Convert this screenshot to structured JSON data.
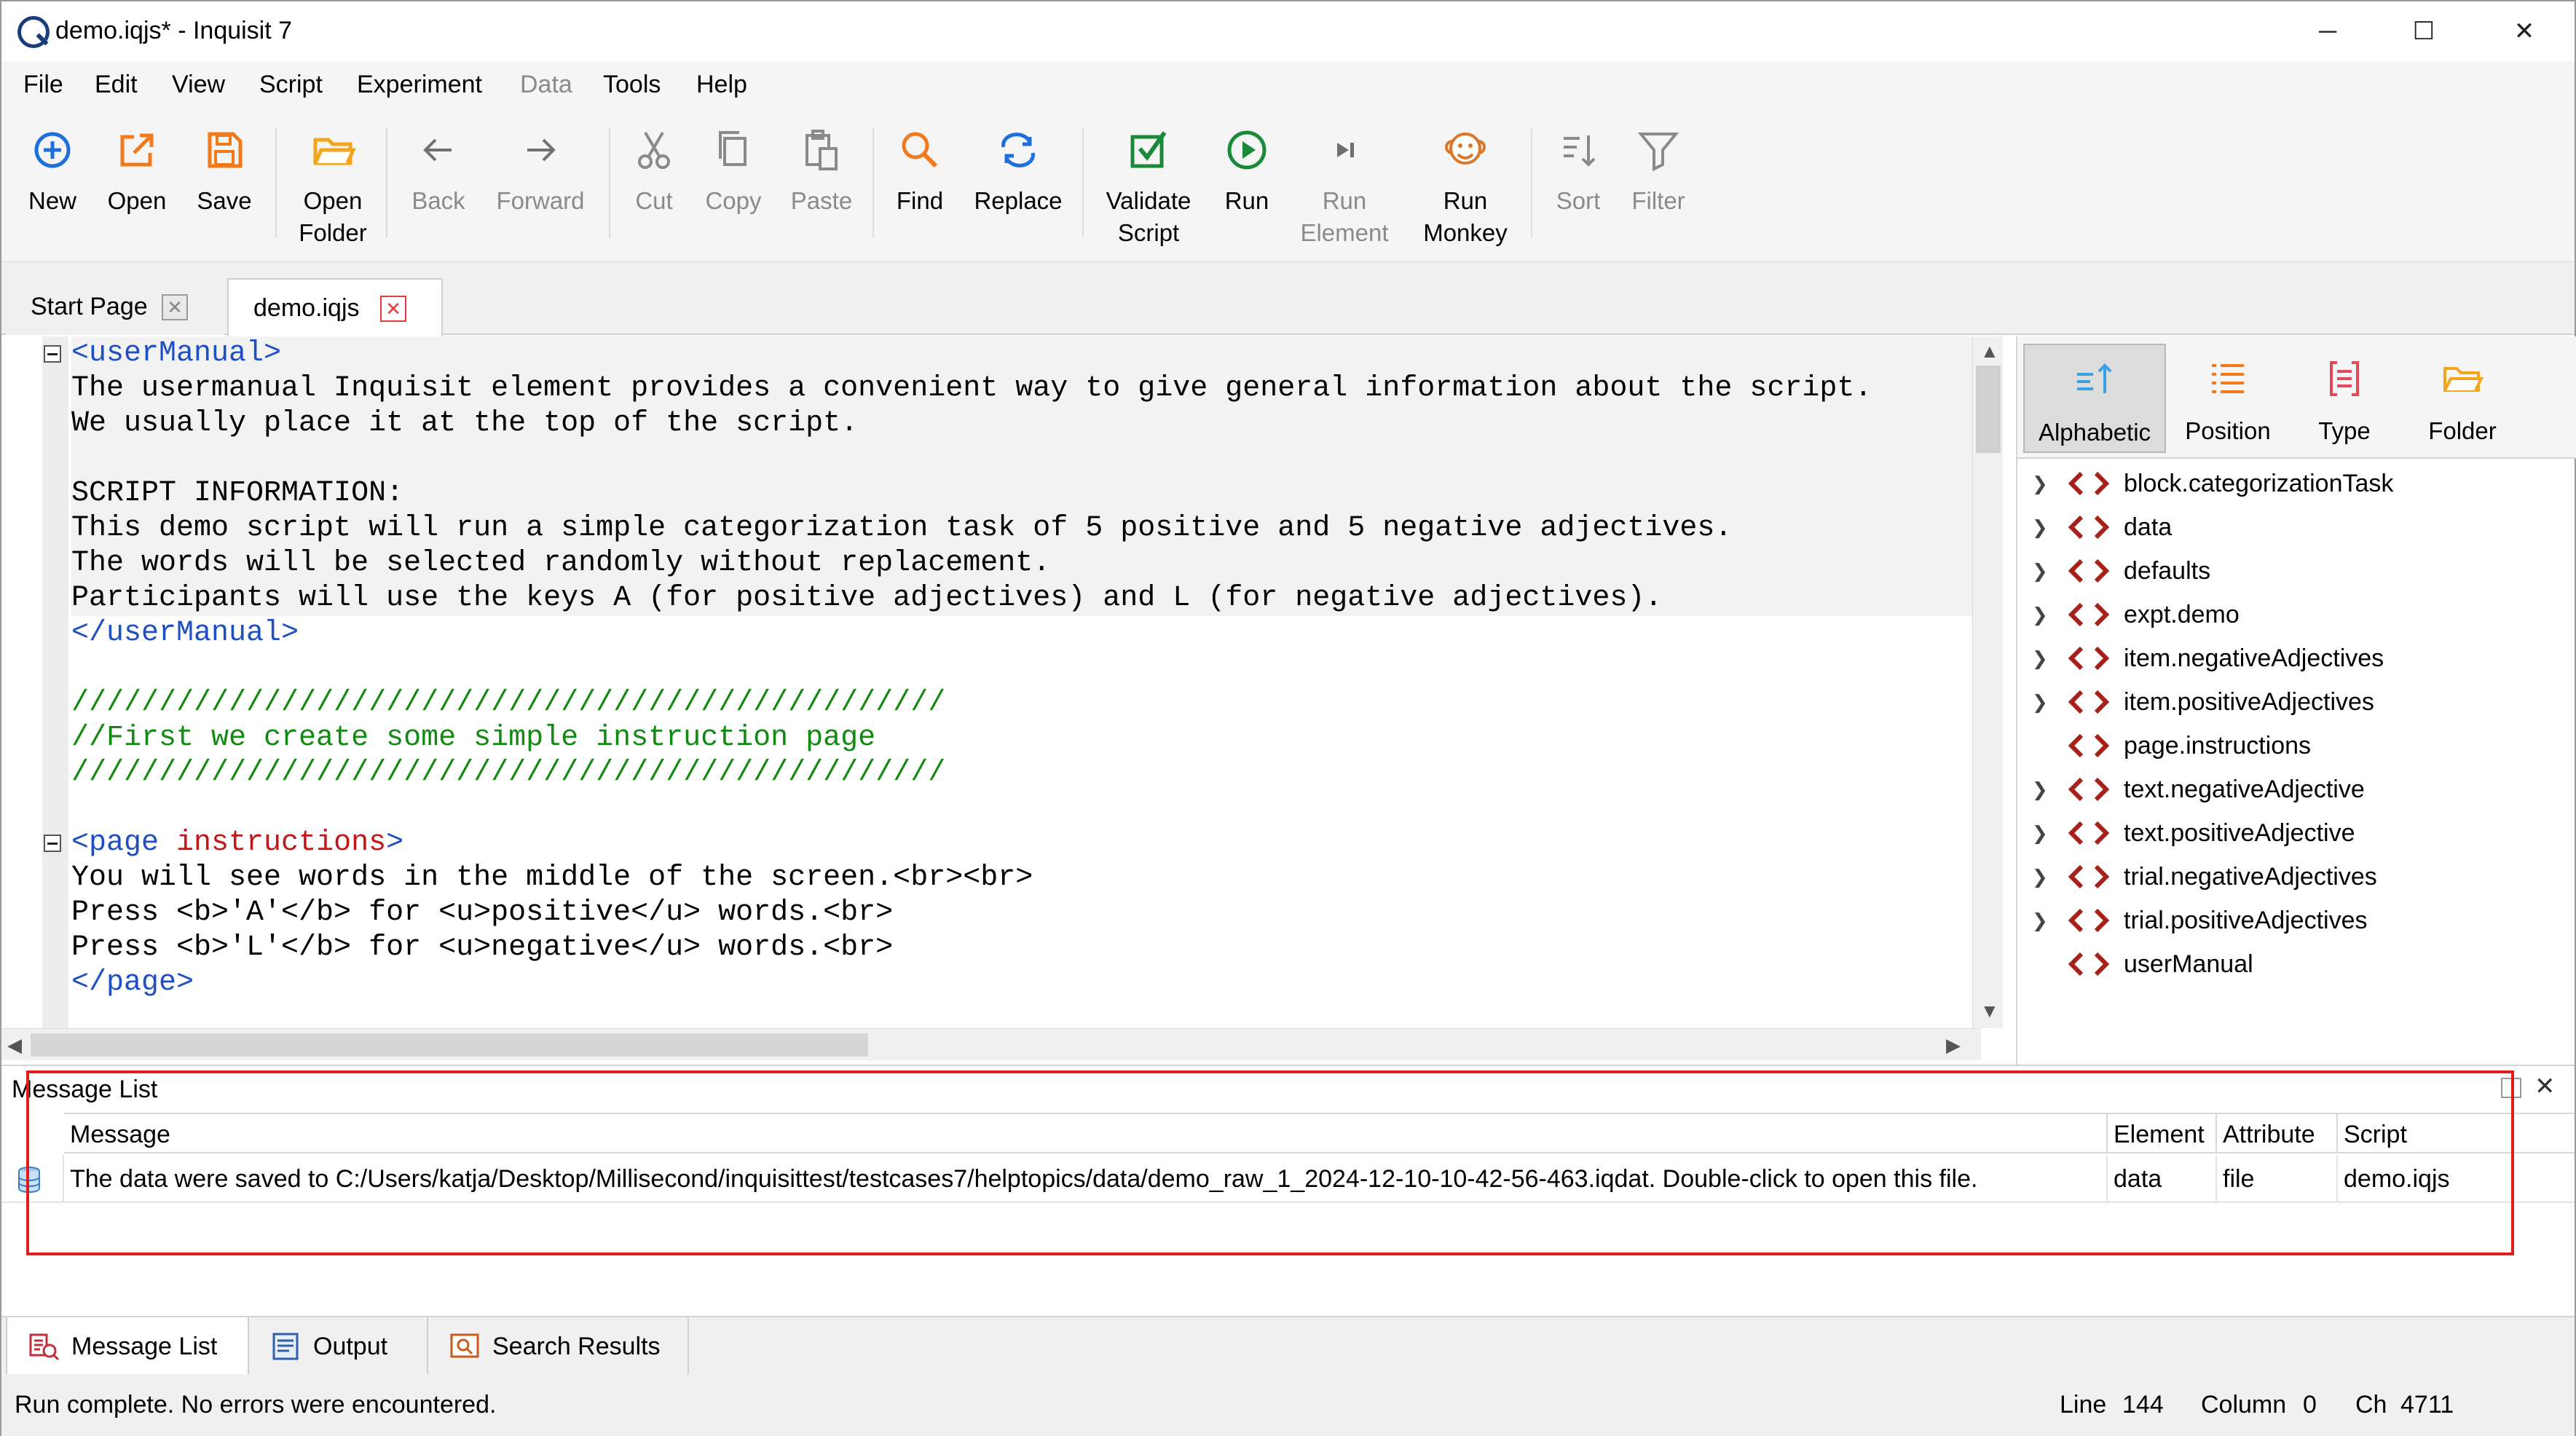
{
  "window": {
    "title": "demo.iqjs* - Inquisit 7",
    "minimize_glyph": "─",
    "maximize_glyph": "☐",
    "close_glyph": "✕"
  },
  "menu": [
    "File",
    "Edit",
    "View",
    "Script",
    "Experiment",
    "Data",
    "Tools",
    "Help"
  ],
  "menu_disabled": [
    "Data"
  ],
  "toolbar": {
    "new": "New",
    "open": "Open",
    "save": "Save",
    "open_folder_1": "Open",
    "open_folder_2": "Folder",
    "back": "Back",
    "forward": "Forward",
    "cut": "Cut",
    "copy": "Copy",
    "paste": "Paste",
    "find": "Find",
    "replace": "Replace",
    "validate_1": "Validate",
    "validate_2": "Script",
    "run": "Run",
    "run_element_1": "Run",
    "run_element_2": "Element",
    "run_monkey_1": "Run",
    "run_monkey_2": "Monkey",
    "sort": "Sort",
    "filter": "Filter"
  },
  "tabs": {
    "start_page": "Start Page",
    "demo": "demo.iqjs",
    "close_glyph": "✕"
  },
  "code": {
    "l1_tag": "<userManual>",
    "l2": "The usermanual Inquisit element provides a convenient way to give general information about the script.",
    "l3": "We usually place it at the top of the script.",
    "l5": "SCRIPT INFORMATION:",
    "l6": "This demo script will run a simple categorization task of 5 positive and 5 negative adjectives.",
    "l7": "The words will be selected randomly without replacement.",
    "l8": "Participants will use the keys A (for positive adjectives) and L (for negative adjectives).",
    "l9_tag": "</userManual>",
    "l11": "//////////////////////////////////////////////////",
    "l12": "//First we create some simple instruction page",
    "l13": "//////////////////////////////////////////////////",
    "l15_open": "<page",
    "l15_name": " instructions",
    "l15_close": ">",
    "l16": "You will see words in the middle of the screen.<br><br>",
    "l17": "Press <b>'A'</b> for <u>positive</u> words.<br>",
    "l18": "Press <b>'L'</b> for <u>negative</u> words.<br>",
    "l19_tag": "</page>"
  },
  "right_panel": {
    "alphabetic": "Alphabetic",
    "position": "Position",
    "type": "Type",
    "folder": "Folder",
    "tree": [
      {
        "label": "block.categorizationTask",
        "expandable": true
      },
      {
        "label": "data",
        "expandable": true
      },
      {
        "label": "defaults",
        "expandable": true
      },
      {
        "label": "expt.demo",
        "expandable": true
      },
      {
        "label": "item.negativeAdjectives",
        "expandable": true
      },
      {
        "label": "item.positiveAdjectives",
        "expandable": true
      },
      {
        "label": "page.instructions",
        "expandable": false
      },
      {
        "label": "text.negativeAdjective",
        "expandable": true
      },
      {
        "label": "text.positiveAdjective",
        "expandable": true
      },
      {
        "label": "trial.negativeAdjectives",
        "expandable": true
      },
      {
        "label": "trial.positiveAdjectives",
        "expandable": true
      },
      {
        "label": "userManual",
        "expandable": false
      }
    ]
  },
  "message_list": {
    "title": "Message List",
    "close_glyph": "✕",
    "columns": {
      "message": "Message",
      "element": "Element",
      "attribute": "Attribute",
      "script": "Script"
    },
    "rows": [
      {
        "message": "The data were saved to C:/Users/katja/Desktop/Millisecond/inquisittest/testcases7/helptopics/data/demo_raw_1_2024-12-10-10-42-56-463.iqdat. Double-click to open this file.",
        "element": "data",
        "attribute": "file",
        "script": "demo.iqjs"
      }
    ]
  },
  "bottom_tabs": {
    "message_list": "Message List",
    "output": "Output",
    "search_results": "Search Results"
  },
  "status": {
    "text": "Run complete. No errors were encountered.",
    "line_label": "Line",
    "line_value": "144",
    "column_label": "Column",
    "column_value": "0",
    "ch_label": "Ch",
    "ch_value": "4711"
  },
  "colors": {
    "accent_blue": "#1e6fd9",
    "orange": "#f07a1c",
    "green": "#1a8a3a",
    "element_icon": "#a8201a",
    "highlight_box": "#e11c1c"
  }
}
